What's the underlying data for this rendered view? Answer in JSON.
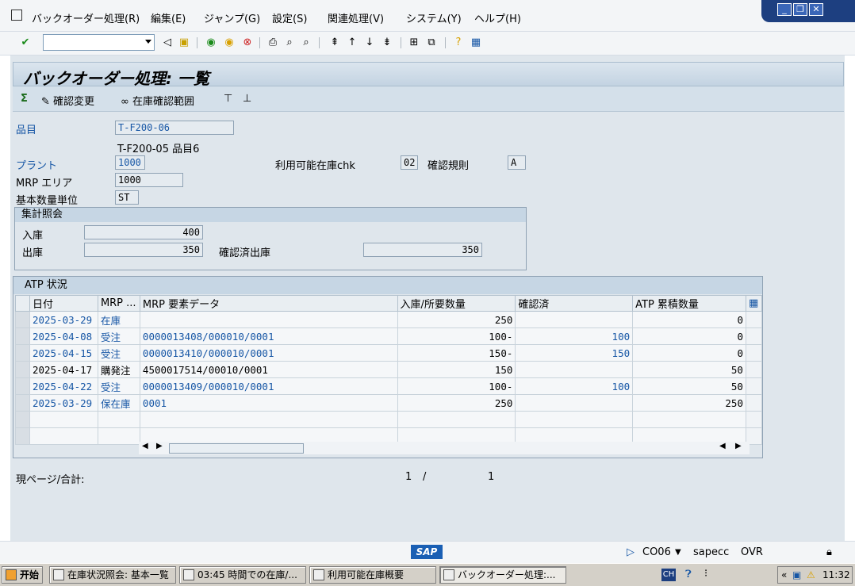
{
  "menubar": {
    "items": [
      "バックオーダー処理(R)",
      "編集(E)",
      "ジャンプ(G)",
      "設定(S)",
      "関連処理(V)",
      "システム(Y)",
      "ヘルプ(H)"
    ]
  },
  "toolbar": {
    "command_value": ""
  },
  "screen": {
    "title": "バックオーダー処理: 一覧",
    "actions": {
      "confirm_change": "確認変更",
      "stock_range": "在庫確認範囲"
    }
  },
  "header": {
    "material_label": "品目",
    "material_value": "T-F200-06",
    "material_desc": "T-F200-05  品目6",
    "plant_label": "プラント",
    "plant_value": "1000",
    "avail_check_label": "利用可能在庫chk",
    "avail_check_value": "02",
    "conf_rule_label": "確認規則",
    "conf_rule_value": "A",
    "mrp_area_label": "MRP エリア",
    "mrp_area_value": "1000",
    "base_uom_label": "基本数量単位",
    "base_uom_value": "ST"
  },
  "summary": {
    "title": "集計照会",
    "receipt_label": "入庫",
    "receipt_value": "400",
    "issue_label": "出庫",
    "issue_value": "350",
    "confirmed_issue_label": "確認済出庫",
    "confirmed_issue_value": "350"
  },
  "atp": {
    "title": "ATP 状況",
    "columns": [
      "日付",
      "MRP ...",
      "MRP 要素データ",
      "入庫/所要数量",
      "確認済",
      "ATP 累積数量"
    ],
    "rows": [
      {
        "date": "2025-03-29",
        "mrp": "在庫",
        "data": "",
        "qty": "250",
        "confirmed": "",
        "cum": "0",
        "blue": true
      },
      {
        "date": "2025-04-08",
        "mrp": "受注",
        "data": "0000013408/000010/0001",
        "qty": "100-",
        "confirmed": "100",
        "cum": "0",
        "blue": true
      },
      {
        "date": "2025-04-15",
        "mrp": "受注",
        "data": "0000013410/000010/0001",
        "qty": "150-",
        "confirmed": "150",
        "cum": "0",
        "blue": true
      },
      {
        "date": "2025-04-17",
        "mrp": "購発注",
        "data": "4500017514/00010/0001",
        "qty": "150",
        "confirmed": "",
        "cum": "50",
        "blue": false
      },
      {
        "date": "2025-04-22",
        "mrp": "受注",
        "data": "0000013409/000010/0001",
        "qty": "100-",
        "confirmed": "100",
        "cum": "50",
        "blue": true
      },
      {
        "date": "2025-03-29",
        "mrp": "保在庫",
        "data": "0001",
        "qty": "250",
        "confirmed": "",
        "cum": "250",
        "blue": true
      }
    ]
  },
  "paging": {
    "label": "現ページ/合計:",
    "current": "1",
    "slash": "/",
    "total": "1"
  },
  "status": {
    "logo": "SAP",
    "tcode": "CO06",
    "server": "sapecc",
    "mode": "OVR"
  },
  "taskbar": {
    "start": "开始",
    "tasks": [
      "在庫状況照会: 基本一覧",
      "03:45 時間での在庫/...",
      "利用可能在庫概要",
      "バックオーダー処理:..."
    ],
    "lang": "CH",
    "clock": "11:32"
  }
}
